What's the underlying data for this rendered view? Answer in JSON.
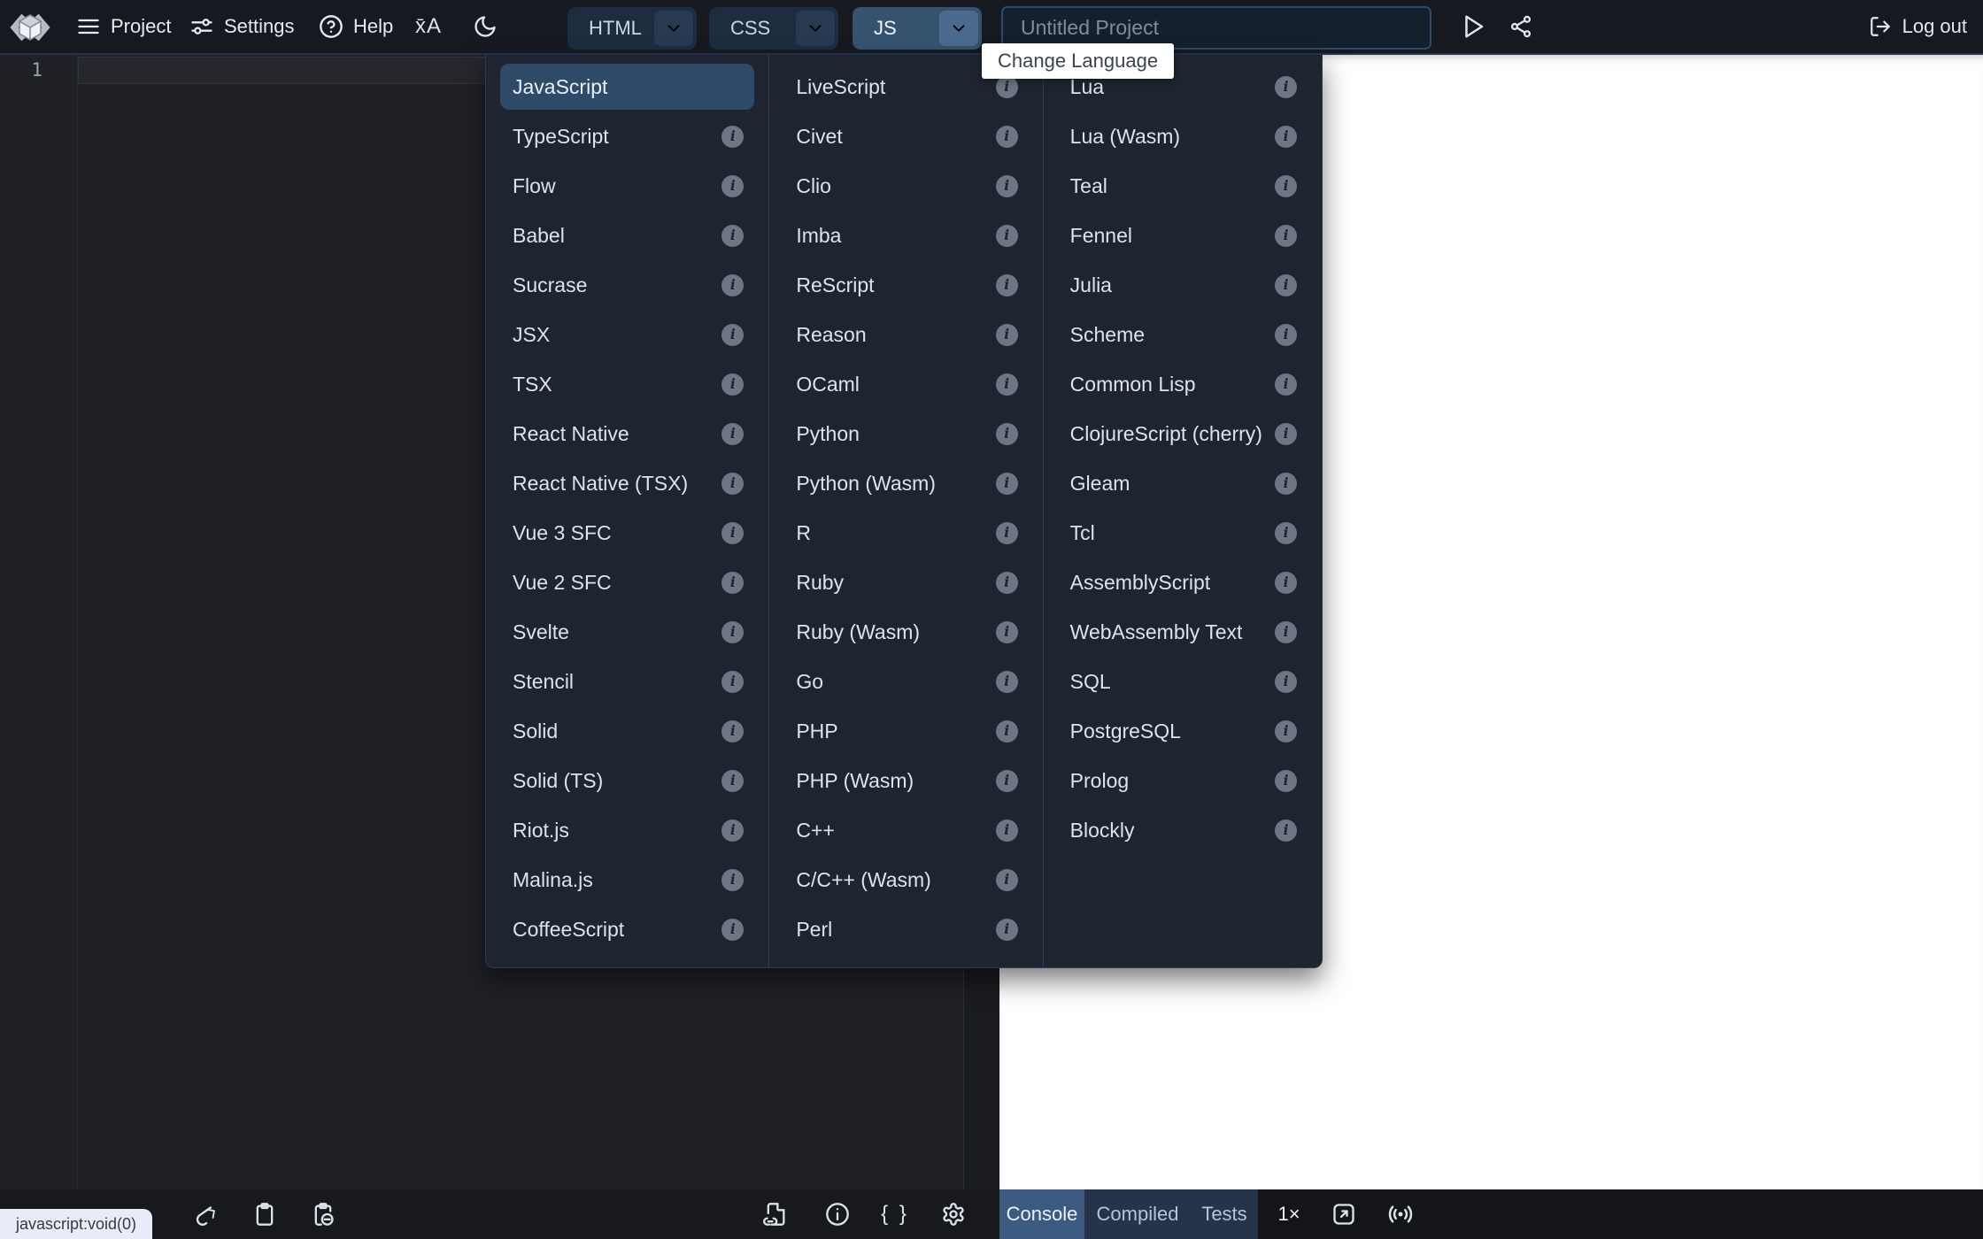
{
  "topbar": {
    "menus": [
      {
        "id": "project",
        "label": "Project"
      },
      {
        "id": "settings",
        "label": "Settings"
      },
      {
        "id": "help",
        "label": "Help"
      }
    ],
    "translate_glyph": "x̄A",
    "file_tabs": [
      {
        "id": "html",
        "label": "HTML",
        "selected": false
      },
      {
        "id": "css",
        "label": "CSS",
        "selected": false
      },
      {
        "id": "js",
        "label": "JS",
        "selected": true
      }
    ],
    "project_title": "Untitled Project",
    "logout_label": "Log out"
  },
  "tooltips": {
    "change_language": "Change Language",
    "status_link": "javascript:void(0)"
  },
  "editor": {
    "line_number": "1"
  },
  "language_menu": {
    "columns": [
      [
        {
          "label": "JavaScript",
          "selected": true,
          "info": false
        },
        {
          "label": "TypeScript",
          "selected": false,
          "info": true
        },
        {
          "label": "Flow",
          "selected": false,
          "info": true
        },
        {
          "label": "Babel",
          "selected": false,
          "info": true
        },
        {
          "label": "Sucrase",
          "selected": false,
          "info": true
        },
        {
          "label": "JSX",
          "selected": false,
          "info": true
        },
        {
          "label": "TSX",
          "selected": false,
          "info": true
        },
        {
          "label": "React Native",
          "selected": false,
          "info": true
        },
        {
          "label": "React Native (TSX)",
          "selected": false,
          "info": true
        },
        {
          "label": "Vue 3 SFC",
          "selected": false,
          "info": true
        },
        {
          "label": "Vue 2 SFC",
          "selected": false,
          "info": true
        },
        {
          "label": "Svelte",
          "selected": false,
          "info": true
        },
        {
          "label": "Stencil",
          "selected": false,
          "info": true
        },
        {
          "label": "Solid",
          "selected": false,
          "info": true
        },
        {
          "label": "Solid (TS)",
          "selected": false,
          "info": true
        },
        {
          "label": "Riot.js",
          "selected": false,
          "info": true
        },
        {
          "label": "Malina.js",
          "selected": false,
          "info": true
        },
        {
          "label": "CoffeeScript",
          "selected": false,
          "info": true
        }
      ],
      [
        {
          "label": "LiveScript",
          "selected": false,
          "info": true
        },
        {
          "label": "Civet",
          "selected": false,
          "info": true
        },
        {
          "label": "Clio",
          "selected": false,
          "info": true
        },
        {
          "label": "Imba",
          "selected": false,
          "info": true
        },
        {
          "label": "ReScript",
          "selected": false,
          "info": true
        },
        {
          "label": "Reason",
          "selected": false,
          "info": true
        },
        {
          "label": "OCaml",
          "selected": false,
          "info": true
        },
        {
          "label": "Python",
          "selected": false,
          "info": true
        },
        {
          "label": "Python (Wasm)",
          "selected": false,
          "info": true
        },
        {
          "label": "R",
          "selected": false,
          "info": true
        },
        {
          "label": "Ruby",
          "selected": false,
          "info": true
        },
        {
          "label": "Ruby (Wasm)",
          "selected": false,
          "info": true
        },
        {
          "label": "Go",
          "selected": false,
          "info": true
        },
        {
          "label": "PHP",
          "selected": false,
          "info": true
        },
        {
          "label": "PHP (Wasm)",
          "selected": false,
          "info": true
        },
        {
          "label": "C++",
          "selected": false,
          "info": true
        },
        {
          "label": "C/C++ (Wasm)",
          "selected": false,
          "info": true
        },
        {
          "label": "Perl",
          "selected": false,
          "info": true
        }
      ],
      [
        {
          "label": "Lua",
          "selected": false,
          "info": true
        },
        {
          "label": "Lua (Wasm)",
          "selected": false,
          "info": true
        },
        {
          "label": "Teal",
          "selected": false,
          "info": true
        },
        {
          "label": "Fennel",
          "selected": false,
          "info": true
        },
        {
          "label": "Julia",
          "selected": false,
          "info": true
        },
        {
          "label": "Scheme",
          "selected": false,
          "info": true
        },
        {
          "label": "Common Lisp",
          "selected": false,
          "info": true
        },
        {
          "label": "ClojureScript (cherry)",
          "selected": false,
          "info": true
        },
        {
          "label": "Gleam",
          "selected": false,
          "info": true
        },
        {
          "label": "Tcl",
          "selected": false,
          "info": true
        },
        {
          "label": "AssemblyScript",
          "selected": false,
          "info": true
        },
        {
          "label": "WebAssembly Text",
          "selected": false,
          "info": true
        },
        {
          "label": "SQL",
          "selected": false,
          "info": true
        },
        {
          "label": "PostgreSQL",
          "selected": false,
          "info": true
        },
        {
          "label": "Prolog",
          "selected": false,
          "info": true
        },
        {
          "label": "Blockly",
          "selected": false,
          "info": true
        }
      ]
    ]
  },
  "bottom_bar": {
    "panel_tabs": [
      {
        "id": "console",
        "label": "Console",
        "selected": true
      },
      {
        "id": "compiled",
        "label": "Compiled",
        "selected": false
      },
      {
        "id": "tests",
        "label": "Tests",
        "selected": false
      }
    ],
    "zoom_label": "1×"
  },
  "colors": {
    "topbar_bg": "#171920",
    "menu_panel_bg": "#1f2530",
    "selected_item_bg": "#2f4a68",
    "selected_tab_bg": "#35536f",
    "console_tab_bg": "#3d5a80",
    "editor_bg": "#1f2125",
    "preview_bg": "#ffffff",
    "tooltip_bg": "#ffffff",
    "status_tooltip_bg": "#e9ecf8"
  }
}
